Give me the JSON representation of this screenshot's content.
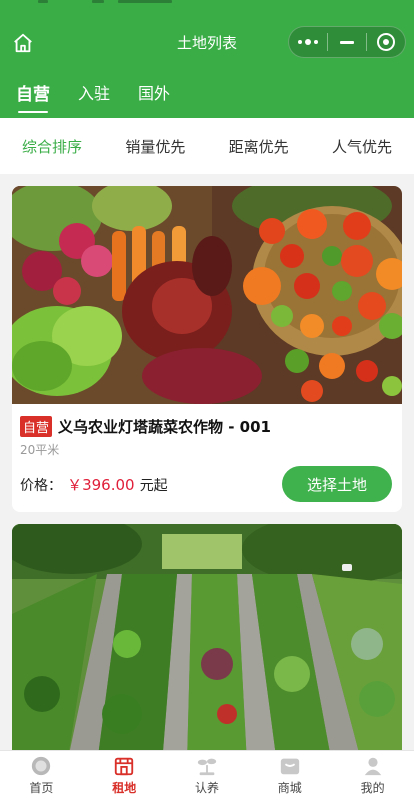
{
  "header": {
    "title": "土地列表",
    "tabs": [
      {
        "label": "自营",
        "active": true
      },
      {
        "label": "入驻",
        "active": false
      },
      {
        "label": "国外",
        "active": false
      }
    ]
  },
  "sort": {
    "items": [
      {
        "label": "综合排序",
        "active": true
      },
      {
        "label": "销量优先",
        "active": false
      },
      {
        "label": "距离优先",
        "active": false
      },
      {
        "label": "人气优先",
        "active": false
      }
    ]
  },
  "cards": [
    {
      "tag": "自营",
      "name": "义乌农业灯塔蔬菜农作物 - 001",
      "area": "20平米",
      "price_label": "价格：",
      "price": "￥396.00",
      "price_suffix": "元起",
      "button": "选择土地"
    }
  ],
  "bottom_nav": [
    {
      "label": "首页",
      "icon": "home-icon",
      "active": false
    },
    {
      "label": "租地",
      "icon": "shop-icon",
      "active": true
    },
    {
      "label": "认养",
      "icon": "sprout-icon",
      "active": false
    },
    {
      "label": "商城",
      "icon": "store-icon",
      "active": false
    },
    {
      "label": "我的",
      "icon": "user-icon",
      "active": false
    }
  ],
  "colors": {
    "brand_green": "#3aad47",
    "price_red": "#e0203a",
    "tag_red": "#d9302a"
  }
}
